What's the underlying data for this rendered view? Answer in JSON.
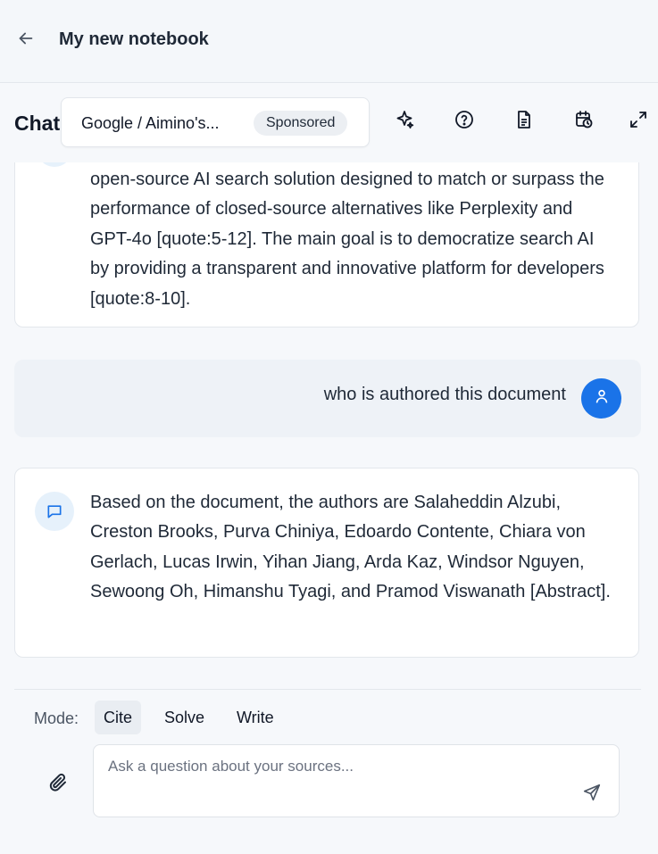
{
  "header": {
    "title": "My new notebook",
    "back_icon": "arrow-left-icon"
  },
  "chat_bar": {
    "label": "Chat",
    "ad": {
      "text": "Google / Aimino's...",
      "badge": "Sponsored"
    },
    "tools": [
      "sparkle-icon",
      "help-circle-icon",
      "document-icon",
      "calendar-clock-icon",
      "expand-icon"
    ]
  },
  "messages": [
    {
      "role": "assistant",
      "text": "open-source AI search solution designed to match or surpass the performance of closed-source alternatives like Perplexity and GPT-4o [quote:5-12]. The main goal is to democratize search AI by providing a transparent and innovative platform for developers [quote:8-10]."
    },
    {
      "role": "user",
      "text": "who is authored this document"
    },
    {
      "role": "assistant",
      "text": "Based on the document, the authors are Salaheddin Alzubi, Creston Brooks, Purva Chiniya, Edoardo Contente, Chiara von Gerlach, Lucas Irwin, Yihan Jiang, Arda Kaz, Windsor Nguyen, Sewoong Oh, Himanshu Tyagi, and Pramod Viswanath [Abstract]."
    }
  ],
  "composer": {
    "mode_label": "Mode:",
    "modes": [
      "Cite",
      "Solve",
      "Write"
    ],
    "active_mode": "Cite",
    "input_value": "",
    "placeholder": "Ask a question about your sources..."
  },
  "colors": {
    "accent": "#1a73e8",
    "chat_icon_bg": "#e6f1fb",
    "user_bubble_bg": "#eef2f7"
  }
}
